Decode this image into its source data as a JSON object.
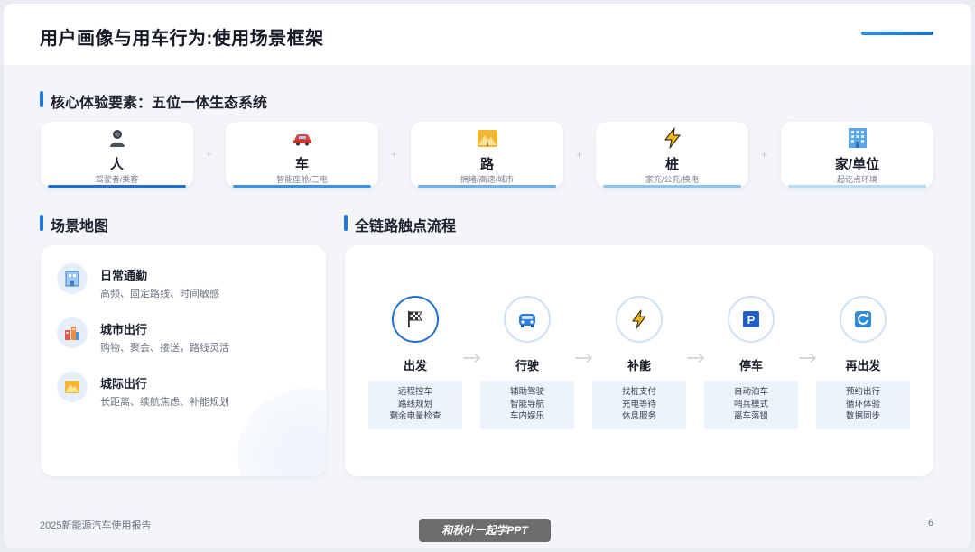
{
  "title": "用户画像与用车行为:使用场景框架",
  "section1": {
    "title": "核心体验要素：五位一体生态系统",
    "items": [
      {
        "name": "人",
        "sub": "驾驶者/乘客",
        "icon": "person-icon",
        "bar": "#1f6fd1"
      },
      {
        "name": "车",
        "sub": "智能座舱/三电",
        "icon": "car-icon",
        "bar": "#3b92e4"
      },
      {
        "name": "路",
        "sub": "拥堵/高速/城市",
        "icon": "road-icon",
        "bar": "#6bb0ea"
      },
      {
        "name": "桩",
        "sub": "家充/公充/换电",
        "icon": "lightning-icon",
        "bar": "#8dc4ef"
      },
      {
        "name": "家/单位",
        "sub": "起讫点环境",
        "icon": "building-icon",
        "bar": "#b7dbf5"
      }
    ],
    "separator": "+"
  },
  "section2": {
    "title": "场景地图",
    "scenes": [
      {
        "name": "日常通勤",
        "desc": "高频、固定路线、时间敏感",
        "icon": "office-icon"
      },
      {
        "name": "城市出行",
        "desc": "购物、聚会、接送，路线灵活",
        "icon": "city-icon"
      },
      {
        "name": "城际出行",
        "desc": "长距离、续航焦虑、补能规划",
        "icon": "mountain-road-icon"
      }
    ]
  },
  "section3": {
    "title": "全链路触点流程",
    "steps": [
      {
        "name": "出发",
        "icon": "flag-icon",
        "lines": [
          "远程控车",
          "路线规划",
          "剩余电量检查"
        ]
      },
      {
        "name": "行驶",
        "icon": "car-icon",
        "lines": [
          "辅助驾驶",
          "智能导航",
          "车内娱乐"
        ]
      },
      {
        "name": "补能",
        "icon": "lightning-icon",
        "lines": [
          "找桩支付",
          "充电等待",
          "休息服务"
        ]
      },
      {
        "name": "停车",
        "icon": "parking-icon",
        "lines": [
          "自动泊车",
          "哨兵模式",
          "离车落锁"
        ]
      },
      {
        "name": "再出发",
        "icon": "refresh-icon",
        "lines": [
          "预约出行",
          "循环体验",
          "数据同步"
        ]
      }
    ],
    "arrow": "→"
  },
  "footer": {
    "report": "2025新能源汽车使用报告",
    "page": "6",
    "watermark": "和秋叶一起学PPT"
  }
}
